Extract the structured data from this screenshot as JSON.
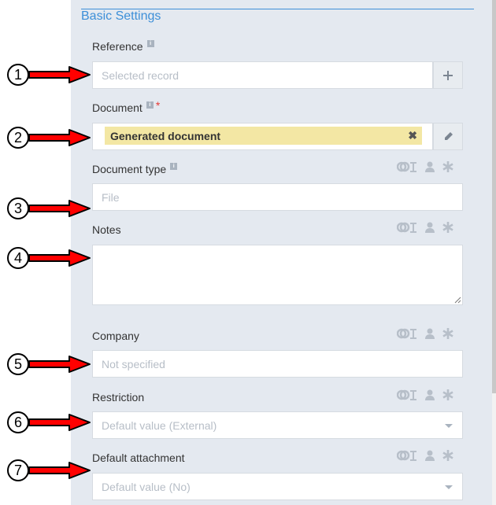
{
  "section": {
    "title": "Basic Settings"
  },
  "fields": {
    "reference": {
      "label": "Reference",
      "placeholder": "Selected record"
    },
    "document": {
      "label": "Document",
      "required_mark": "*",
      "value": "Generated document"
    },
    "document_type": {
      "label": "Document type",
      "placeholder": "File"
    },
    "notes": {
      "label": "Notes"
    },
    "company": {
      "label": "Company",
      "placeholder": "Not specified"
    },
    "restriction": {
      "label": "Restriction",
      "value": "Default value (External)"
    },
    "default_attachment": {
      "label": "Default attachment",
      "value": "Default value (No)"
    }
  },
  "callouts": [
    "1",
    "2",
    "3",
    "4",
    "5",
    "6",
    "7"
  ],
  "icons": {
    "add": "plus-icon",
    "edit": "pencil-icon",
    "clear": "close-icon",
    "info": "info-icon",
    "tools": [
      "link-text-icon",
      "user-icon",
      "asterisk-icon"
    ]
  },
  "colors": {
    "panel": "#e4e9f0",
    "accent": "#3d8fd8",
    "chip": "#f3e7a4",
    "arrow": "#ff0000",
    "required": "#e53935"
  }
}
